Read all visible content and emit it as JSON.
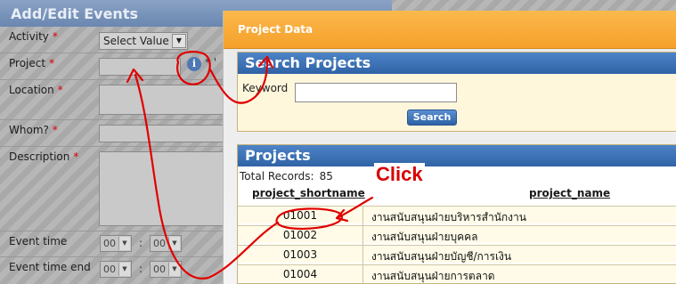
{
  "form": {
    "title": "Add/Edit Events",
    "activity_label": "Activity",
    "project_label": "Project",
    "location_label": "Location",
    "whom_label": "Whom?",
    "description_label": "Description",
    "event_time_label": "Event time",
    "event_time_end_label": "Event time end",
    "required_mark": "*",
    "activity_select_value": "Select Value",
    "hour_value": "00",
    "minute_value": "00",
    "time_separator": ":",
    "project_hint": "* '"
  },
  "dialog": {
    "title": "Project Data",
    "search_panel": {
      "title": "Search Projects",
      "keyword_label": "Keyword",
      "keyword_value": "",
      "search_button": "Search"
    },
    "projects_panel": {
      "title": "Projects",
      "total_label": "Total Records:",
      "total_value": "85",
      "columns": [
        "project_shortname",
        "project_name"
      ],
      "rows": [
        [
          "01001",
          "งานสนับสนุนฝ่ายบริหารสำนักงาน"
        ],
        [
          "01002",
          "งานสนับสนุนฝ่ายบุคคล"
        ],
        [
          "01003",
          "งานสนับสนุนฝ่ายบัญชี/การเงิน"
        ],
        [
          "01004",
          "งานสนับสนุนฝ่ายการตลาด"
        ]
      ]
    }
  },
  "annotation": {
    "click_text": "Click",
    "color": "#e00000"
  },
  "icons": {
    "info": "info-icon",
    "dropdown": "chevron-down-icon"
  }
}
